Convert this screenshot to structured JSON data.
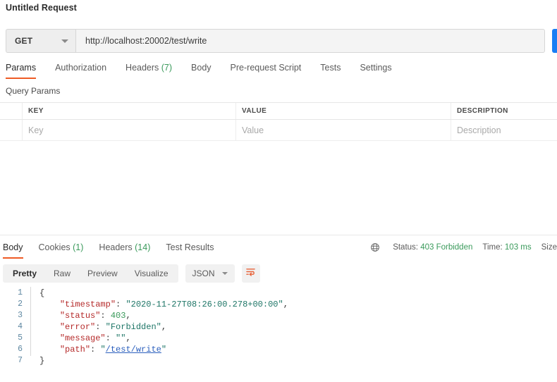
{
  "request": {
    "title": "Untitled Request",
    "method": "GET",
    "url": "http://localhost:20002/test/write",
    "send_label": "",
    "tabs": [
      {
        "label": "Params",
        "count": "",
        "active": true
      },
      {
        "label": "Authorization",
        "count": "",
        "active": false
      },
      {
        "label": "Headers",
        "count": "(7)",
        "active": false
      },
      {
        "label": "Body",
        "count": "",
        "active": false
      },
      {
        "label": "Pre-request Script",
        "count": "",
        "active": false
      },
      {
        "label": "Tests",
        "count": "",
        "active": false
      },
      {
        "label": "Settings",
        "count": "",
        "active": false
      }
    ],
    "query_params": {
      "section_label": "Query Params",
      "columns": [
        "KEY",
        "VALUE",
        "DESCRIPTION"
      ],
      "rows": [
        {
          "key": "Key",
          "value": "Value",
          "description": "Description"
        }
      ]
    }
  },
  "response": {
    "tabs": [
      {
        "label": "Body",
        "count": "",
        "active": true
      },
      {
        "label": "Cookies",
        "count": "(1)",
        "active": false
      },
      {
        "label": "Headers",
        "count": "(14)",
        "active": false
      },
      {
        "label": "Test Results",
        "count": "",
        "active": false
      }
    ],
    "meta": {
      "status_label": "Status:",
      "status_value": "403 Forbidden",
      "time_label": "Time:",
      "time_value": "103 ms",
      "size_label": "Size"
    },
    "toolbar": {
      "views": [
        {
          "label": "Pretty",
          "active": true
        },
        {
          "label": "Raw",
          "active": false
        },
        {
          "label": "Preview",
          "active": false
        },
        {
          "label": "Visualize",
          "active": false
        }
      ],
      "format": "JSON"
    },
    "body_lines": [
      {
        "no": "1",
        "fold": true,
        "segments": [
          {
            "t": "{",
            "c": "brace"
          }
        ]
      },
      {
        "no": "2",
        "fold": true,
        "segments": [
          {
            "t": "    ",
            "c": "p"
          },
          {
            "t": "\"timestamp\"",
            "c": "k"
          },
          {
            "t": ": ",
            "c": "p"
          },
          {
            "t": "\"2020-11-27T08:26:00.278+00:00\"",
            "c": "s"
          },
          {
            "t": ",",
            "c": "p"
          }
        ]
      },
      {
        "no": "3",
        "fold": true,
        "segments": [
          {
            "t": "    ",
            "c": "p"
          },
          {
            "t": "\"status\"",
            "c": "k"
          },
          {
            "t": ": ",
            "c": "p"
          },
          {
            "t": "403",
            "c": "n"
          },
          {
            "t": ",",
            "c": "p"
          }
        ]
      },
      {
        "no": "4",
        "fold": true,
        "segments": [
          {
            "t": "    ",
            "c": "p"
          },
          {
            "t": "\"error\"",
            "c": "k"
          },
          {
            "t": ": ",
            "c": "p"
          },
          {
            "t": "\"Forbidden\"",
            "c": "s"
          },
          {
            "t": ",",
            "c": "p"
          }
        ]
      },
      {
        "no": "5",
        "fold": true,
        "segments": [
          {
            "t": "    ",
            "c": "p"
          },
          {
            "t": "\"message\"",
            "c": "k"
          },
          {
            "t": ": ",
            "c": "p"
          },
          {
            "t": "\"\"",
            "c": "s"
          },
          {
            "t": ",",
            "c": "p"
          }
        ]
      },
      {
        "no": "6",
        "fold": true,
        "segments": [
          {
            "t": "    ",
            "c": "p"
          },
          {
            "t": "\"path\"",
            "c": "k"
          },
          {
            "t": ": ",
            "c": "p"
          },
          {
            "t": "\"",
            "c": "s"
          },
          {
            "t": "/test/write",
            "c": "lnk"
          },
          {
            "t": "\"",
            "c": "s"
          }
        ]
      },
      {
        "no": "7",
        "fold": false,
        "segments": [
          {
            "t": "}",
            "c": "brace"
          }
        ]
      }
    ]
  },
  "colors": {
    "accent_orange": "#ef5b25",
    "send_blue": "#1a7ef4",
    "status_green": "#3a9a5b",
    "json_key": "#b52a2a",
    "json_string": "#1d7566",
    "json_link": "#2b5fbd"
  },
  "icons": {
    "method_caret": "chevron-down-icon",
    "format_caret": "chevron-down-icon",
    "wrap": "word-wrap-icon",
    "globe": "globe-icon"
  }
}
